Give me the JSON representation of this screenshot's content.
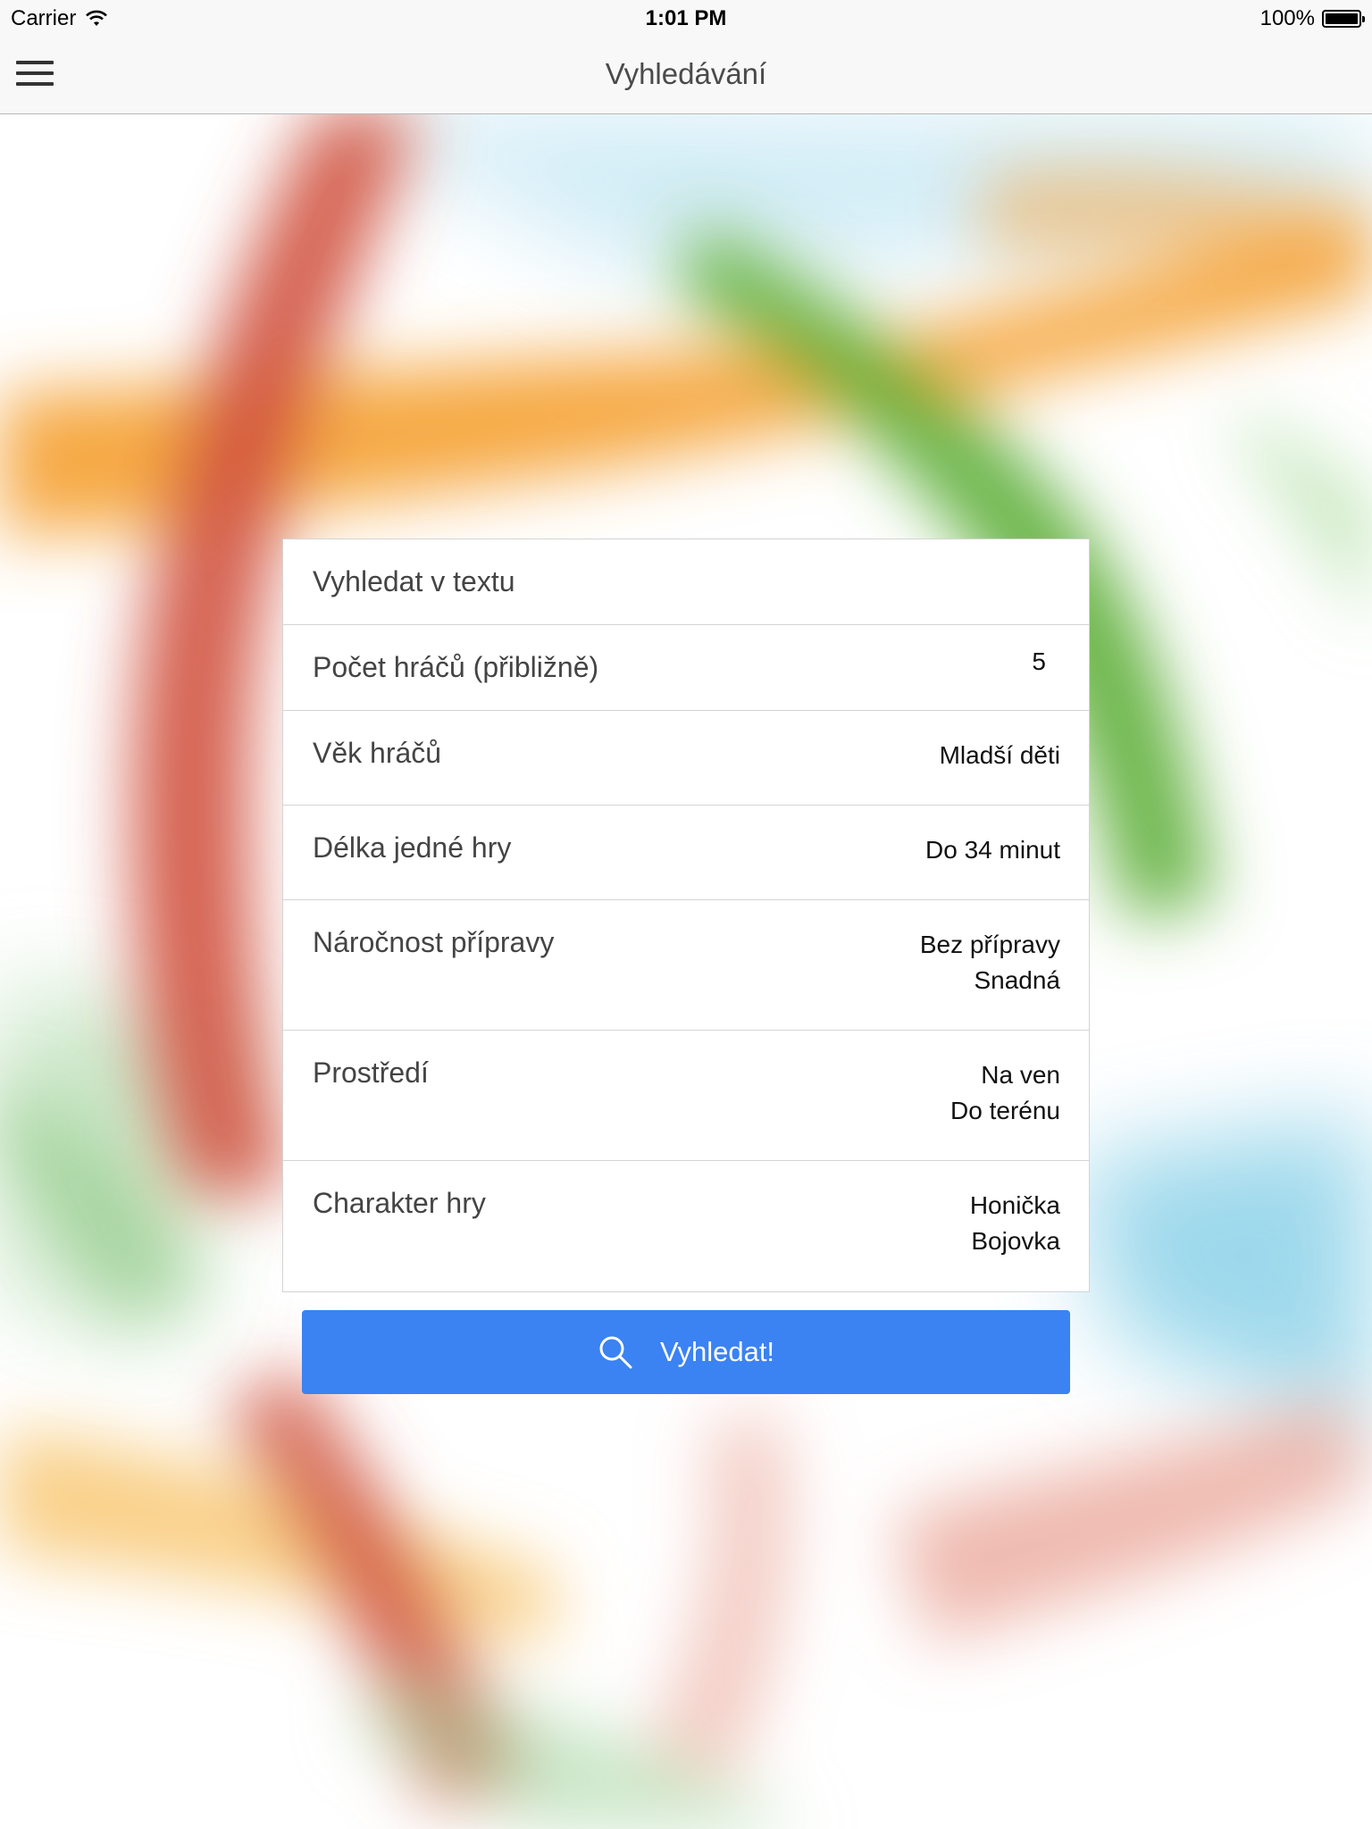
{
  "status_bar": {
    "carrier": "Carrier",
    "time": "1:01 PM",
    "battery": "100%",
    "battery_level": 1.0
  },
  "nav": {
    "title": "Vyhledávání",
    "menu_icon": "hamburger-menu-icon"
  },
  "form": {
    "text_search": {
      "placeholder": "Vyhledat v textu",
      "value": ""
    },
    "players": {
      "label": "Počet hráčů (přibližně)",
      "value": "5"
    },
    "age": {
      "label": "Věk hráčů",
      "value": "Mladší děti"
    },
    "duration": {
      "label": "Délka jedné hry",
      "value": "Do 34 minut"
    },
    "preparation": {
      "label": "Náročnost přípravy",
      "values": [
        "Bez přípravy",
        "Snadná"
      ]
    },
    "environment": {
      "label": "Prostředí",
      "values": [
        "Na ven",
        "Do terénu"
      ]
    },
    "character": {
      "label": "Charakter hry",
      "values": [
        "Honička",
        "Bojovka"
      ]
    }
  },
  "search_button": {
    "label": "Vyhledat!",
    "icon": "search-icon",
    "color": "#3b82f3"
  },
  "colors": {
    "background_red": "#d0533f",
    "background_orange": "#f6a43a",
    "background_green": "#5aac33",
    "background_blue": "#4cb8dc"
  }
}
